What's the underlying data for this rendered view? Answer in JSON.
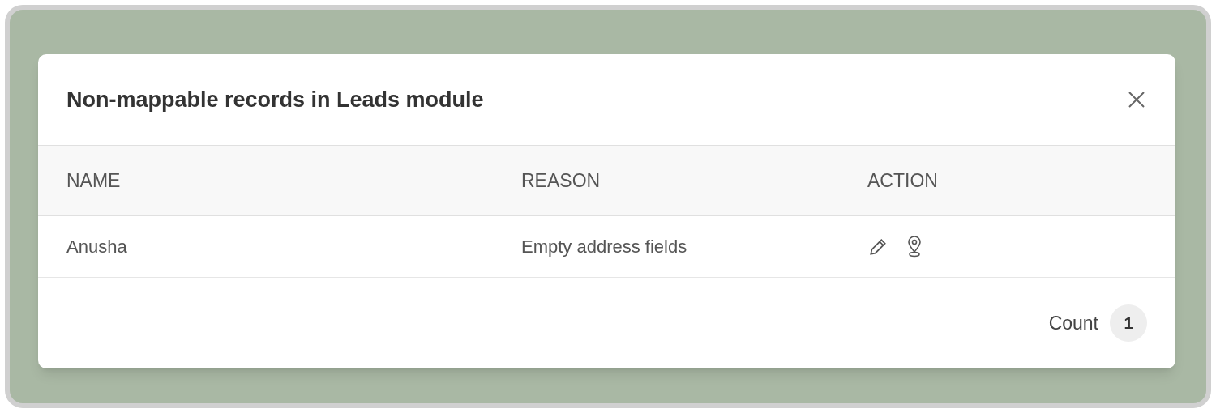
{
  "dialog": {
    "title": "Non-mappable records in Leads module",
    "table": {
      "columns": [
        "NAME",
        "REASON",
        "ACTION"
      ],
      "rows": [
        {
          "name": "Anusha",
          "reason": "Empty address fields"
        }
      ]
    },
    "footer": {
      "label": "Count",
      "count": "1"
    }
  }
}
